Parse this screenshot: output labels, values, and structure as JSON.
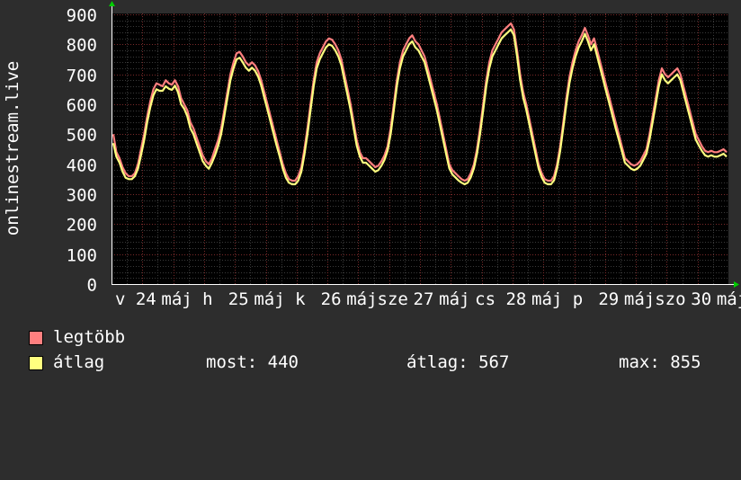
{
  "chart_data": {
    "type": "line",
    "ylabel": "onlinestream.live",
    "ylim": [
      0,
      900
    ],
    "yticks": [
      0,
      100,
      200,
      300,
      400,
      500,
      600,
      700,
      800,
      900
    ],
    "grid": true,
    "x_tick_labels": [
      "v",
      "24",
      "máj",
      "h",
      "25",
      "máj",
      "k",
      "26",
      "máj",
      "sze",
      "27",
      "máj",
      "cs",
      "28",
      "máj",
      "p",
      "29",
      "máj",
      "szo",
      "30",
      "máj"
    ],
    "x_points": 200,
    "series": [
      {
        "name": "legtöbb",
        "color": "#ff7f7f",
        "values": [
          500,
          440,
          420,
          390,
          370,
          360,
          360,
          370,
          400,
          450,
          500,
          560,
          610,
          650,
          670,
          665,
          660,
          680,
          670,
          665,
          680,
          660,
          620,
          600,
          580,
          540,
          520,
          490,
          460,
          430,
          410,
          400,
          420,
          450,
          480,
          520,
          580,
          640,
          700,
          740,
          770,
          775,
          760,
          740,
          730,
          740,
          730,
          710,
          680,
          640,
          600,
          560,
          520,
          480,
          440,
          400,
          370,
          350,
          345,
          345,
          360,
          390,
          450,
          520,
          600,
          680,
          740,
          770,
          790,
          810,
          820,
          815,
          800,
          780,
          750,
          700,
          650,
          600,
          540,
          480,
          440,
          420,
          420,
          410,
          400,
          390,
          395,
          410,
          430,
          460,
          520,
          600,
          680,
          740,
          780,
          800,
          820,
          830,
          810,
          800,
          780,
          760,
          720,
          680,
          640,
          600,
          550,
          500,
          450,
          400,
          380,
          370,
          360,
          350,
          345,
          350,
          370,
          400,
          450,
          520,
          600,
          680,
          740,
          780,
          800,
          820,
          840,
          850,
          860,
          870,
          850,
          780,
          700,
          640,
          600,
          550,
          500,
          450,
          400,
          370,
          350,
          345,
          345,
          360,
          400,
          460,
          540,
          620,
          690,
          740,
          780,
          810,
          830,
          855,
          830,
          800,
          820,
          780,
          740,
          700,
          660,
          620,
          580,
          540,
          500,
          460,
          420,
          410,
          400,
          395,
          400,
          410,
          430,
          450,
          500,
          560,
          620,
          680,
          720,
          700,
          690,
          700,
          710,
          720,
          700,
          660,
          620,
          580,
          540,
          500,
          480,
          460,
          445,
          440,
          445,
          440,
          440,
          445,
          450,
          440
        ]
      },
      {
        "name": "átlag",
        "color": "#ffff7f",
        "values": [
          470,
          425,
          405,
          375,
          355,
          350,
          350,
          360,
          385,
          430,
          480,
          540,
          590,
          630,
          650,
          645,
          645,
          660,
          652,
          648,
          662,
          640,
          600,
          585,
          560,
          520,
          500,
          470,
          440,
          410,
          395,
          385,
          405,
          430,
          460,
          500,
          560,
          620,
          680,
          720,
          750,
          755,
          740,
          722,
          712,
          722,
          712,
          692,
          662,
          622,
          582,
          542,
          502,
          462,
          425,
          385,
          355,
          338,
          333,
          333,
          345,
          375,
          432,
          500,
          580,
          660,
          720,
          750,
          770,
          790,
          800,
          795,
          780,
          760,
          730,
          680,
          630,
          580,
          520,
          462,
          425,
          405,
          405,
          395,
          385,
          375,
          380,
          395,
          415,
          445,
          500,
          580,
          660,
          720,
          760,
          780,
          800,
          810,
          790,
          780,
          760,
          740,
          700,
          660,
          620,
          580,
          530,
          482,
          434,
          386,
          366,
          356,
          346,
          338,
          333,
          338,
          356,
          386,
          434,
          500,
          580,
          660,
          720,
          760,
          780,
          800,
          820,
          830,
          840,
          850,
          830,
          760,
          680,
          622,
          582,
          532,
          482,
          434,
          386,
          356,
          338,
          333,
          333,
          346,
          386,
          444,
          522,
          600,
          670,
          720,
          760,
          790,
          810,
          835,
          810,
          780,
          800,
          760,
          720,
          680,
          640,
          600,
          560,
          520,
          482,
          444,
          405,
          395,
          385,
          380,
          385,
          395,
          415,
          435,
          482,
          540,
          600,
          660,
          700,
          680,
          670,
          680,
          690,
          700,
          680,
          640,
          600,
          560,
          520,
          482,
          462,
          444,
          430,
          425,
          430,
          425,
          425,
          430,
          435,
          425
        ]
      }
    ]
  },
  "legend": {
    "items": [
      {
        "label": "legtöbb",
        "color": "#ff7f7f"
      },
      {
        "label": "átlag",
        "color": "#ffff7f"
      }
    ],
    "stats": {
      "now": "most: 440",
      "avg": "átlag: 567",
      "max": "max: 855"
    }
  }
}
